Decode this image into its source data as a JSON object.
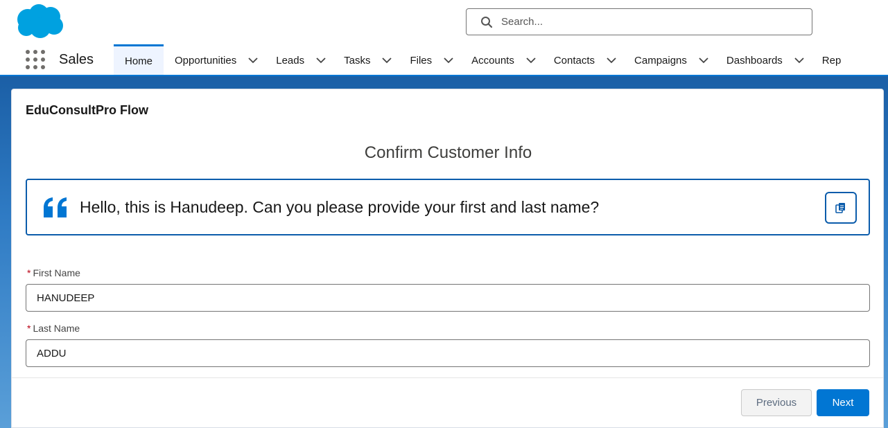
{
  "header": {
    "search_placeholder": "Search...",
    "logo_icon": "salesforce-cloud-icon"
  },
  "nav": {
    "app_name": "Sales",
    "tabs": [
      {
        "label": "Home",
        "active": true
      },
      {
        "label": "Opportunities"
      },
      {
        "label": "Leads"
      },
      {
        "label": "Tasks"
      },
      {
        "label": "Files"
      },
      {
        "label": "Accounts"
      },
      {
        "label": "Contacts"
      },
      {
        "label": "Campaigns"
      },
      {
        "label": "Dashboards"
      },
      {
        "label": "Rep"
      }
    ]
  },
  "card": {
    "title": "EduConsultPro Flow",
    "screen_title": "Confirm Customer Info",
    "script_text": "Hello, this is Hanudeep. Can you please provide your first and last name?",
    "fields": [
      {
        "label": "First Name",
        "required_mark": "*",
        "value": "HANUDEEP"
      },
      {
        "label": "Last Name",
        "required_mark": "*",
        "value": "ADDU"
      }
    ],
    "previous_label": "Previous",
    "next_label": "Next"
  },
  "colors": {
    "brand_blue": "#0176d3",
    "border_blue": "#0b5cab",
    "required_red": "#ba0517"
  }
}
